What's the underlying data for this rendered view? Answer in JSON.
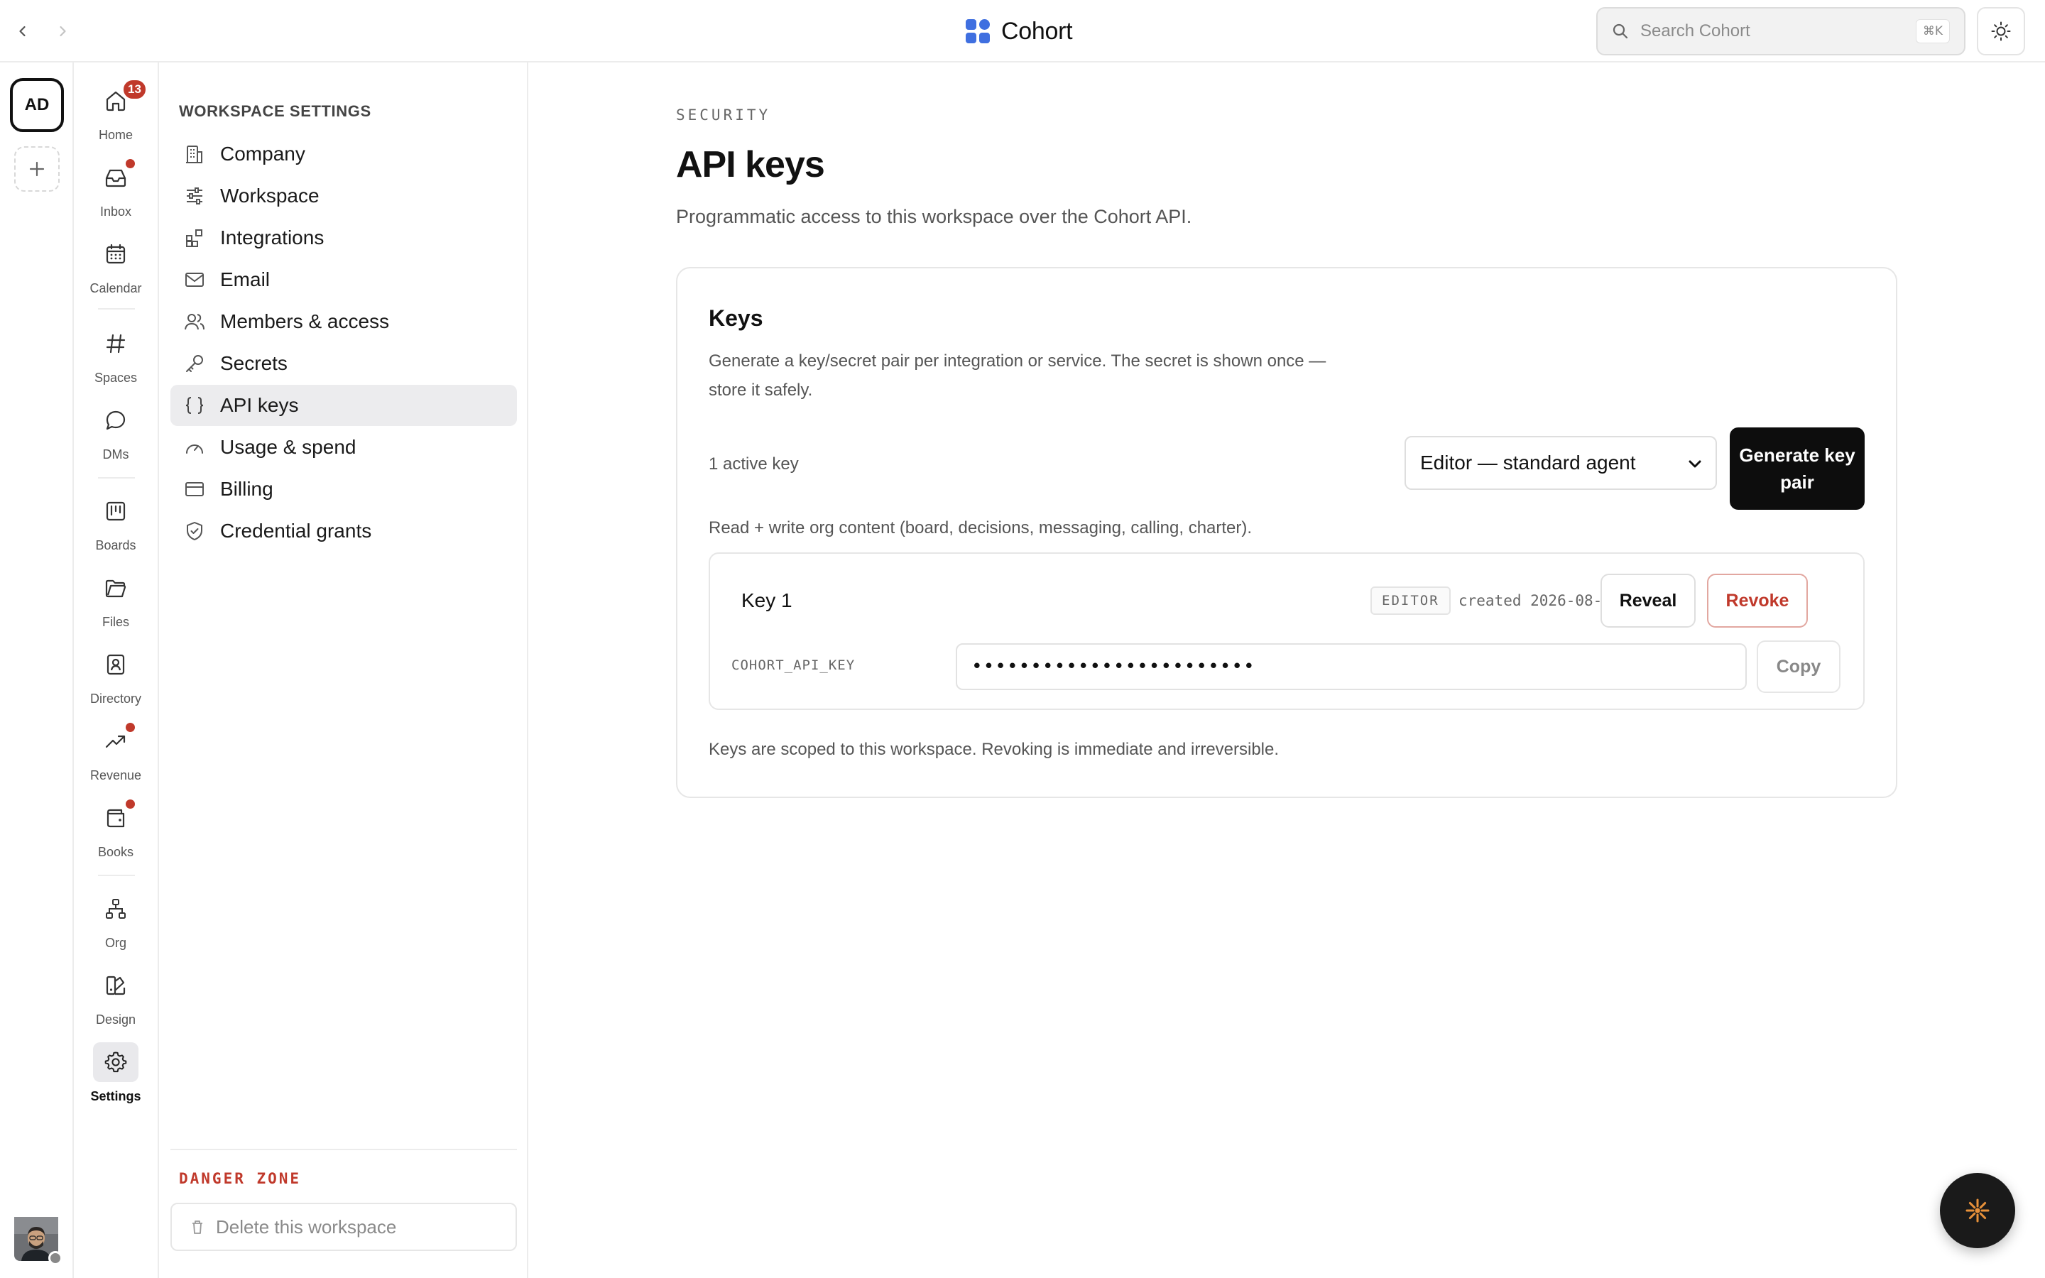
{
  "topbar": {
    "brand": "Cohort",
    "search_placeholder": "Search Cohort",
    "search_shortcut": "⌘K"
  },
  "workspace_rail": {
    "current_initials": "AD"
  },
  "app_nav": {
    "items": [
      {
        "label": "Home",
        "icon": "home-icon",
        "badge_count": "13"
      },
      {
        "label": "Inbox",
        "icon": "inbox-icon",
        "has_dot": true
      },
      {
        "label": "Calendar",
        "icon": "calendar-icon"
      },
      {
        "label": "Spaces",
        "icon": "hash-icon"
      },
      {
        "label": "DMs",
        "icon": "chat-bubble-icon"
      },
      {
        "label": "Boards",
        "icon": "kanban-icon"
      },
      {
        "label": "Files",
        "icon": "folder-icon"
      },
      {
        "label": "Directory",
        "icon": "contact-book-icon"
      },
      {
        "label": "Revenue",
        "icon": "trend-up-icon",
        "has_dot": true
      },
      {
        "label": "Books",
        "icon": "wallet-icon",
        "has_dot": true
      },
      {
        "label": "Org",
        "icon": "org-chart-icon"
      },
      {
        "label": "Design",
        "icon": "palette-icon"
      },
      {
        "label": "Settings",
        "icon": "gear-icon",
        "active": true
      }
    ]
  },
  "settings_sidebar": {
    "heading": "WORKSPACE SETTINGS",
    "items": [
      {
        "label": "Company",
        "icon": "building-icon"
      },
      {
        "label": "Workspace",
        "icon": "sliders-icon"
      },
      {
        "label": "Integrations",
        "icon": "blocks-icon"
      },
      {
        "label": "Email",
        "icon": "mail-icon"
      },
      {
        "label": "Members & access",
        "icon": "users-icon"
      },
      {
        "label": "Secrets",
        "icon": "key-icon"
      },
      {
        "label": "API keys",
        "icon": "braces-icon",
        "active": true
      },
      {
        "label": "Usage & spend",
        "icon": "gauge-icon"
      },
      {
        "label": "Billing",
        "icon": "credit-card-icon"
      },
      {
        "label": "Credential grants",
        "icon": "shield-check-icon"
      }
    ],
    "danger_title": "DANGER ZONE",
    "delete_label": "Delete this workspace"
  },
  "main": {
    "eyebrow": "SECURITY",
    "title": "API keys",
    "description": "Programmatic access to this workspace over the Cohort API.",
    "card": {
      "title": "Keys",
      "description": "Generate a key/secret pair per integration or service. The secret is shown once — store it safely.",
      "active_count": "1 active key",
      "role_select_value": "Editor — standard agent",
      "generate_label": "Generate key pair",
      "role_description": "Read + write org content (board, decisions, messaging, calling, charter).",
      "key": {
        "name": "Key 1",
        "role_tag": "EDITOR",
        "created": "created 2026-08-06",
        "reveal_label": "Reveal",
        "revoke_label": "Revoke",
        "env_label": "COHORT_API_KEY",
        "masked_value": "••••••••••••••••••••••••",
        "copy_label": "Copy"
      },
      "footnote": "Keys are scoped to this workspace. Revoking is immediate and irreversible."
    }
  },
  "colors": {
    "accent_blue": "#3f6fe0",
    "danger": "#c0392b",
    "primary_button": "#0d0d0d",
    "assistant_spark": "#e8913a"
  }
}
